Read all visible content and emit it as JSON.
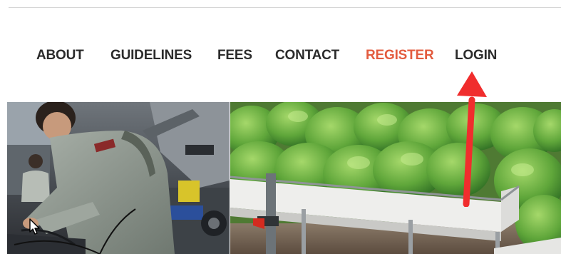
{
  "nav": {
    "items": [
      {
        "label": "ABOUT",
        "active": false
      },
      {
        "label": "GUIDELINES",
        "active": false
      },
      {
        "label": "FEES",
        "active": false
      },
      {
        "label": "CONTACT",
        "active": false
      },
      {
        "label": "REGISTER",
        "active": true
      },
      {
        "label": "LOGIN",
        "active": false
      }
    ]
  },
  "colors": {
    "nav_text": "#2b2b2b",
    "nav_active": "#e35c3f",
    "annotation_arrow": "#f02d2d"
  },
  "images": {
    "left_photo": "worker-with-machinery-photo",
    "right_photo": "hydroponic-lettuce-photo"
  },
  "overlays": {
    "annotation_arrow": "red-arrow-pointing-to-login",
    "mouse_cursor": "pointer-arrow-icon"
  }
}
